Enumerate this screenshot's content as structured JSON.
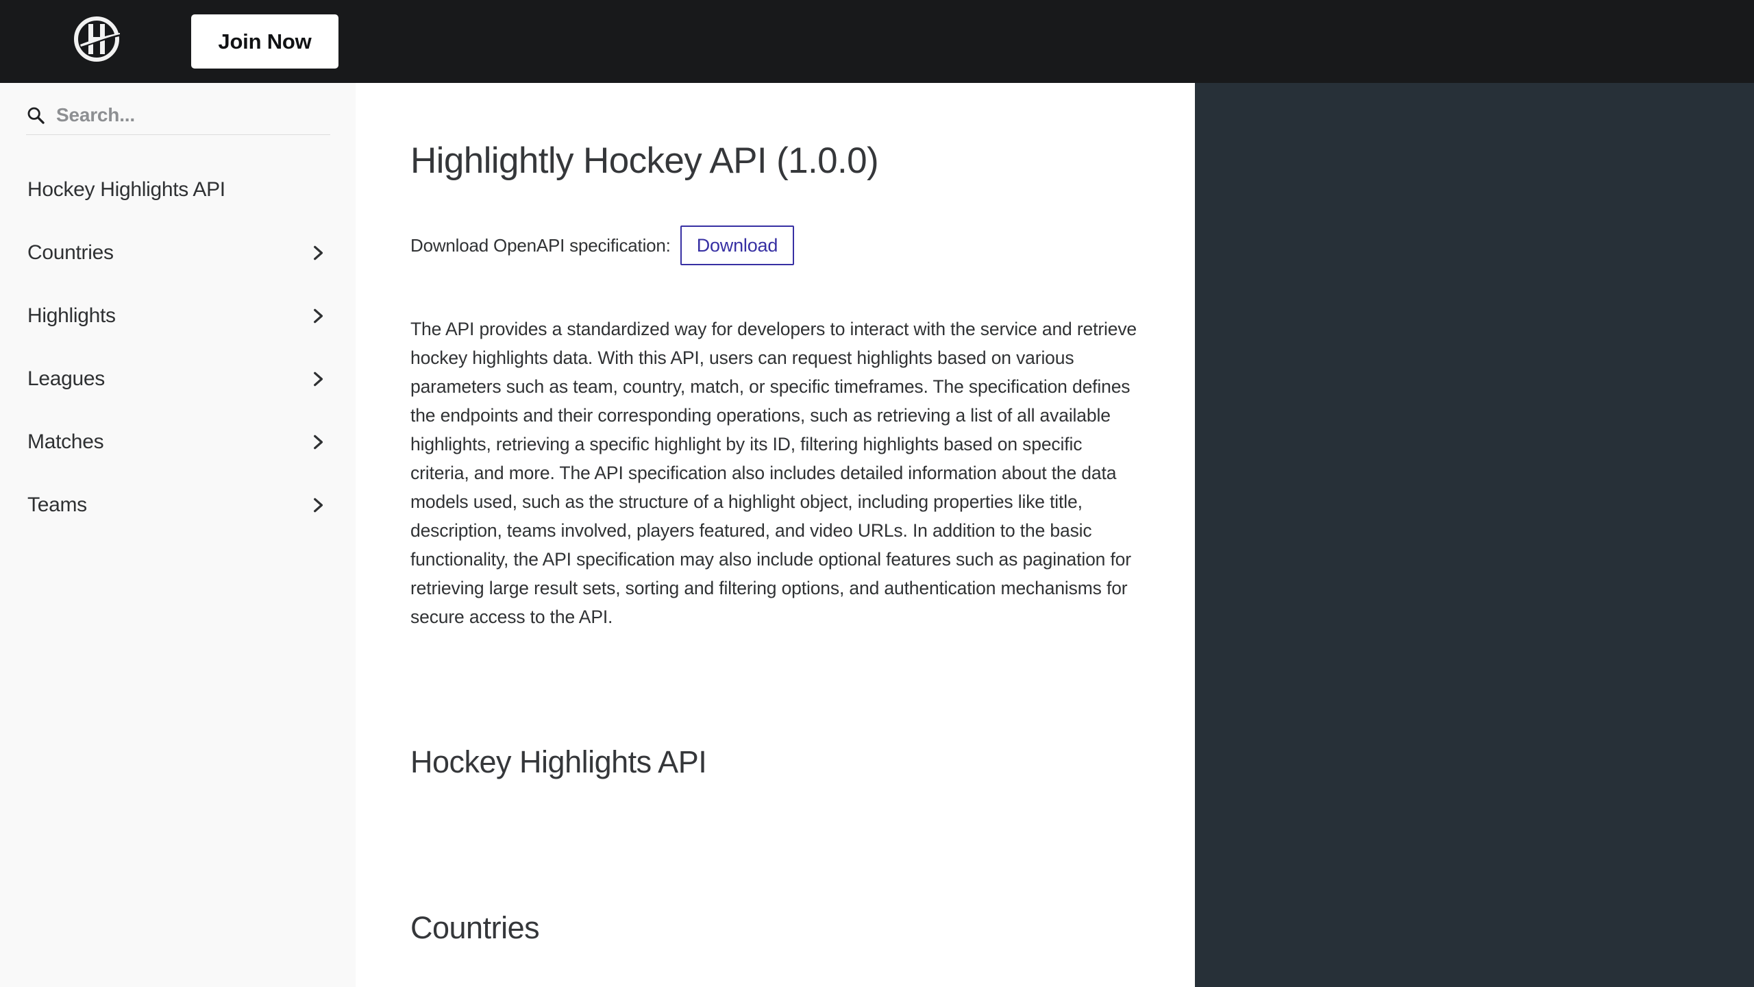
{
  "topbar": {
    "logo_icon": "highlightly-circle-h-logo",
    "join_label": "Join Now"
  },
  "sidebar": {
    "search": {
      "icon": "search-icon",
      "placeholder": "Search...",
      "value": ""
    },
    "items": [
      {
        "label": "Hockey Highlights API",
        "has_chevron": false
      },
      {
        "label": "Countries",
        "has_chevron": true,
        "chevron_icon": "chevron-right-icon"
      },
      {
        "label": "Highlights",
        "has_chevron": true,
        "chevron_icon": "chevron-right-icon"
      },
      {
        "label": "Leagues",
        "has_chevron": true,
        "chevron_icon": "chevron-right-icon"
      },
      {
        "label": "Matches",
        "has_chevron": true,
        "chevron_icon": "chevron-right-icon"
      },
      {
        "label": "Teams",
        "has_chevron": true,
        "chevron_icon": "chevron-right-icon"
      }
    ]
  },
  "main": {
    "title": "Highlightly Hockey API (1.0.0)",
    "download_label": "Download OpenAPI specification:",
    "download_button": "Download",
    "description": "The API provides a standardized way for developers to interact with the service and retrieve hockey highlights data. With this API, users can request highlights based on various parameters such as team, country, match, or specific timeframes. The specification defines the endpoints and their corresponding operations, such as retrieving a list of all available highlights, retrieving a specific highlight by its ID, filtering highlights based on specific criteria, and more. The API specification also includes detailed information about the data models used, such as the structure of a highlight object, including properties like title, description, teams involved, players featured, and video URLs. In addition to the basic functionality, the API specification may also include optional features such as pagination for retrieving large result sets, sorting and filtering options, and authentication mechanisms for secure access to the API.",
    "section_1": "Hockey Highlights API",
    "section_2": "Countries"
  },
  "colors": {
    "topbar_bg": "#18191b",
    "sidebar_bg": "#f9f9f9",
    "content_bg": "#ffffff",
    "right_panel_bg": "#273038",
    "accent_link": "#3730a3",
    "text_primary": "#303234",
    "text_heading": "#35373a",
    "placeholder": "#8d8f92"
  }
}
